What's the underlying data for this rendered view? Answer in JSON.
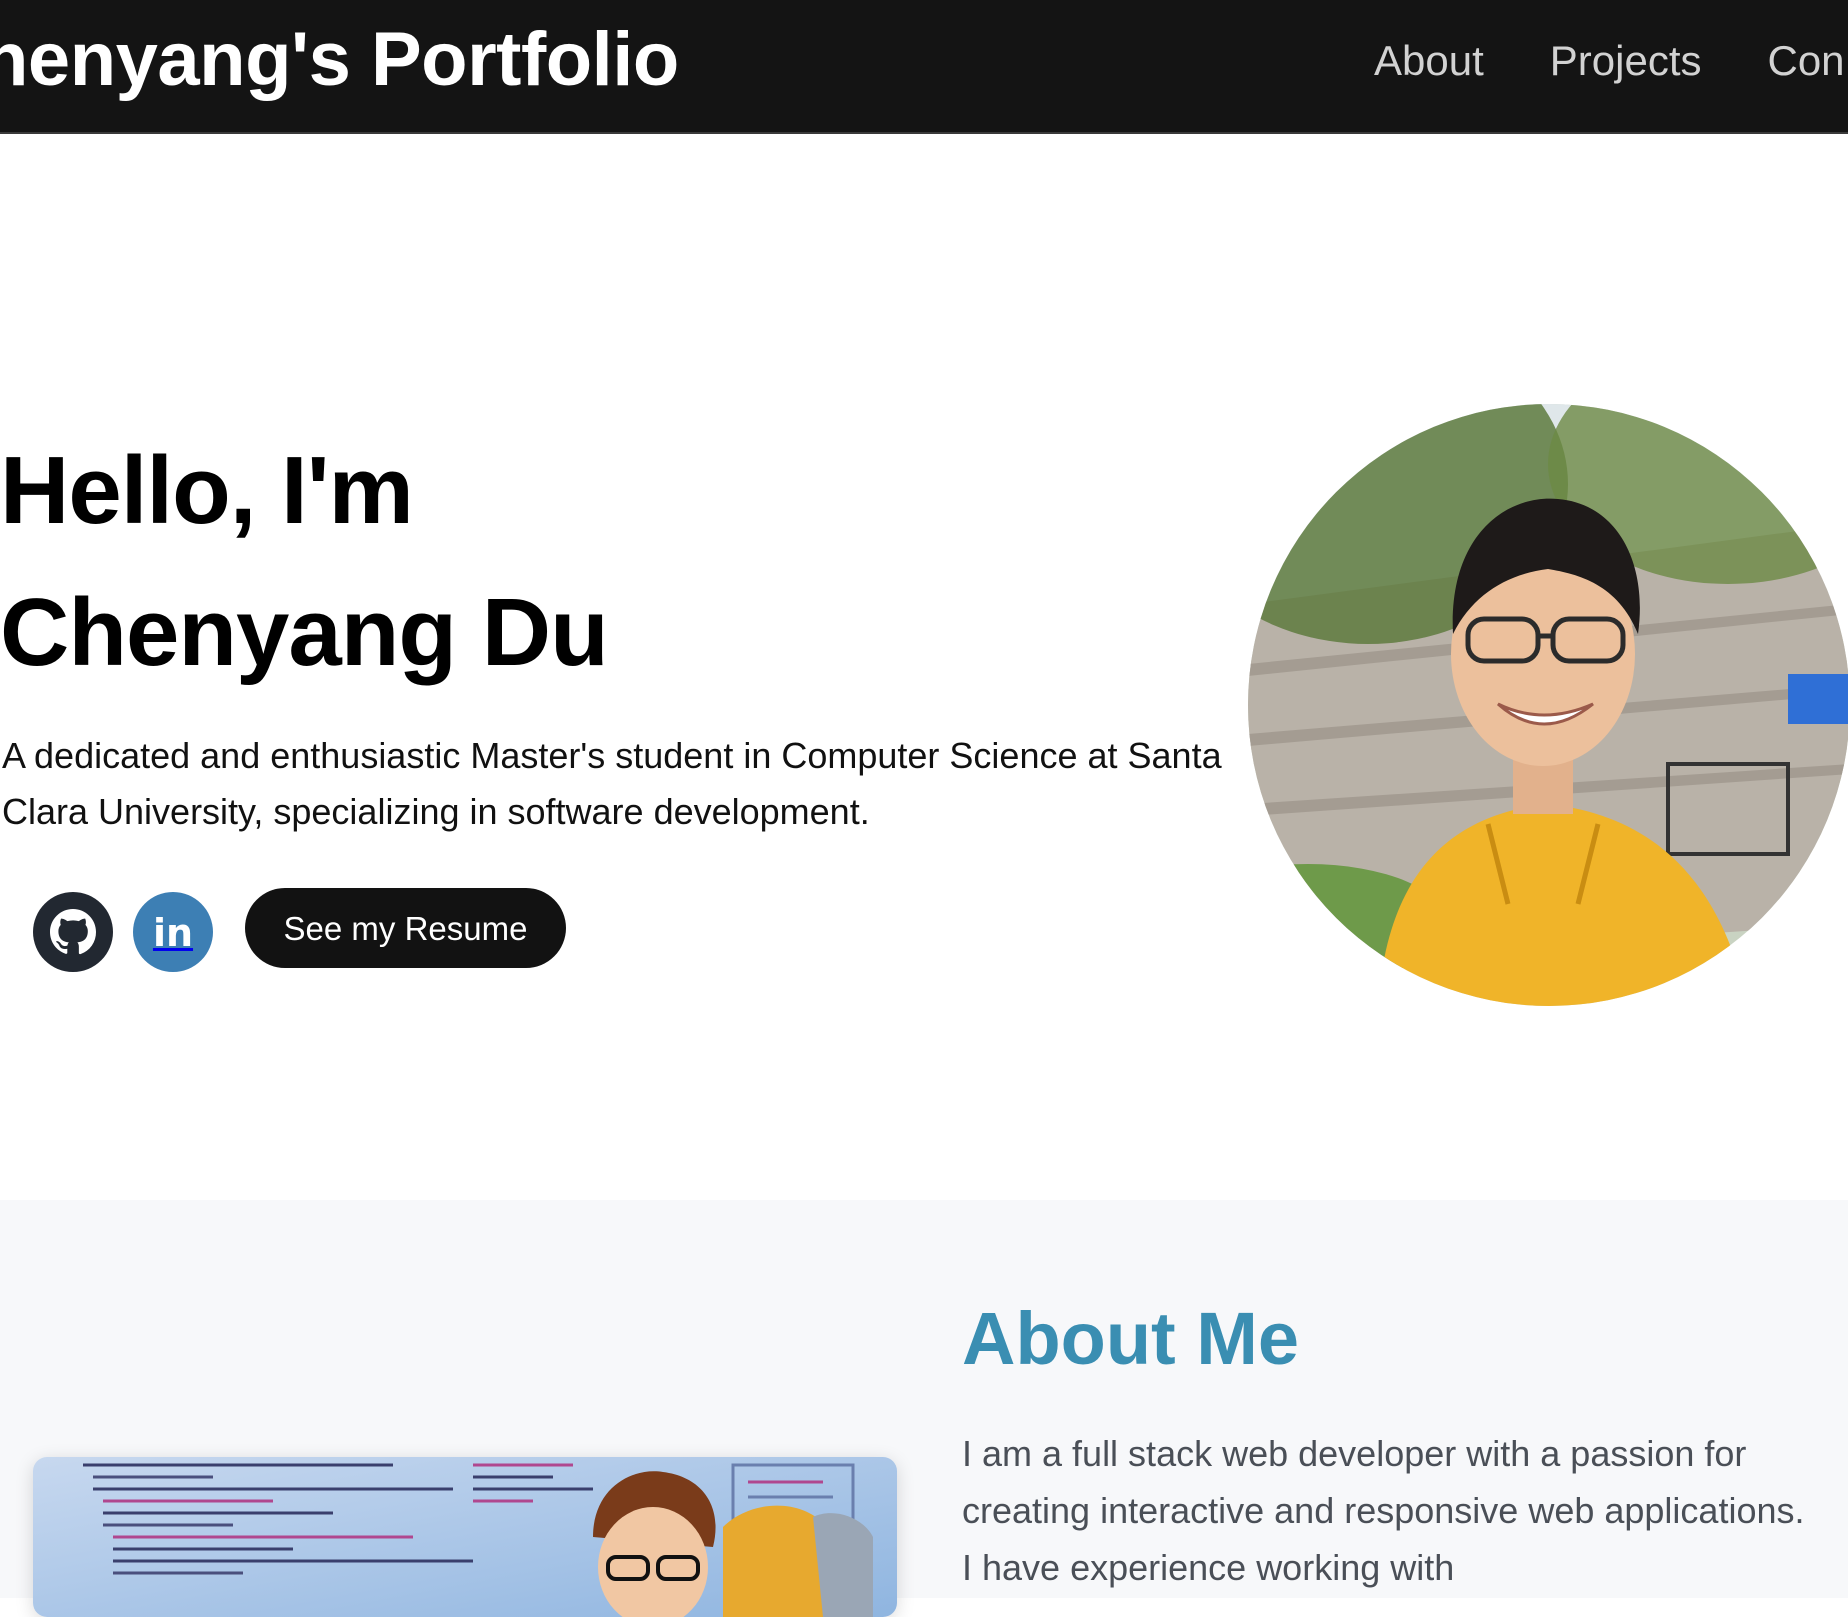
{
  "header": {
    "brand": "henyang's Portfolio",
    "nav": [
      {
        "label": "About"
      },
      {
        "label": "Projects"
      },
      {
        "label": "Con"
      }
    ]
  },
  "hero": {
    "greeting": "Hello, I'm",
    "name": "Chenyang Du",
    "description": "A dedicated and enthusiastic Master's student in Computer Science at Santa Clara University, specializing in software development.",
    "social": {
      "github_icon": "github-icon",
      "linkedin_icon": "linkedin-icon",
      "linkedin_text": "in"
    },
    "resume_button": "See my Resume",
    "photo_icon": "profile-photo"
  },
  "about": {
    "title": "About Me",
    "text": "I am a full stack web developer with a passion for creating interactive and responsive web applications. I have experience working with",
    "image_icon": "developer-illustration"
  },
  "colors": {
    "header_bg": "#141414",
    "accent": "#3a8eb2",
    "github_bg": "#222831",
    "linkedin_bg": "#3d7fb4",
    "about_bg": "#f7f8fa"
  }
}
